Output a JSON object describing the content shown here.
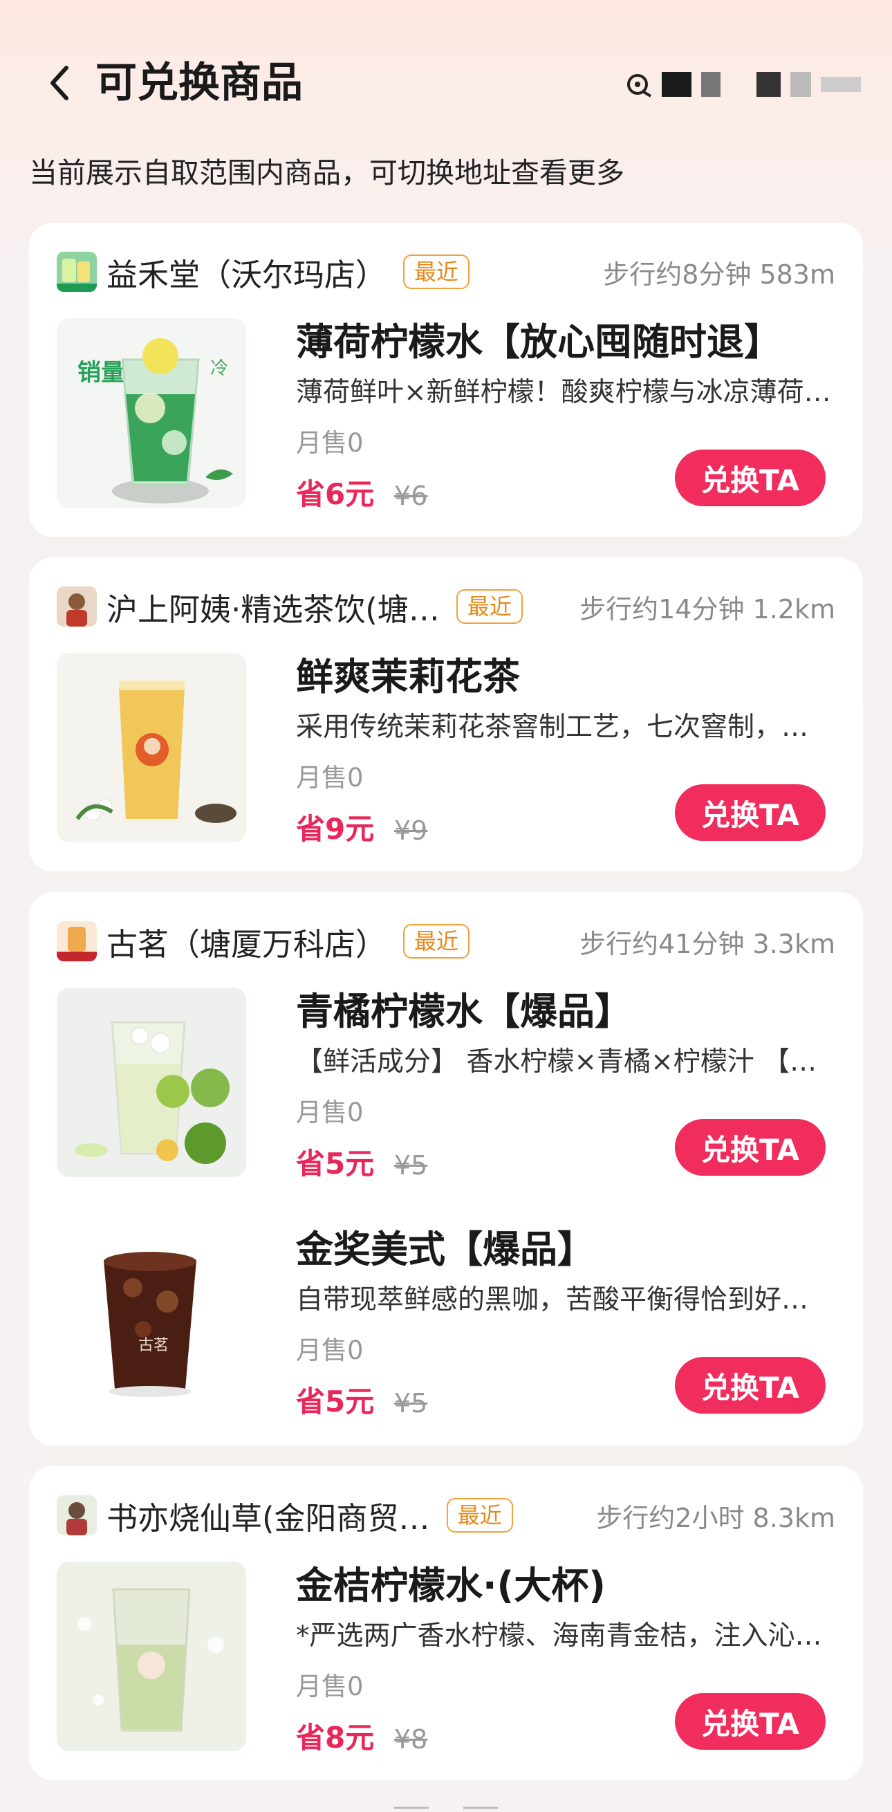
{
  "header": {
    "title": "可兑换商品",
    "subtitle": "当前展示自取范围内商品，可切换地址查看更多"
  },
  "exchange_label": "兑换TA",
  "recent_label": "最近",
  "stores": [
    {
      "name": "益禾堂（沃尔玛店）",
      "distance": "步行约8分钟 583m",
      "products": [
        {
          "name": "薄荷柠檬水【放心囤随时退】",
          "desc": "薄荷鲜叶×新鲜柠檬！酸爽柠檬与冰凉薄荷…",
          "sales": "月售0",
          "save": "省6元",
          "price": "¥6",
          "img_text": "销量过亿",
          "img_tag": "冷"
        }
      ]
    },
    {
      "name": "沪上阿姨·精选茶饮(塘…",
      "distance": "步行约14分钟 1.2km",
      "products": [
        {
          "name": "鲜爽茉莉花茶",
          "desc": "采用传统茉莉花茶窨制工艺，七次窨制，…",
          "sales": "月售0",
          "save": "省9元",
          "price": "¥9"
        }
      ]
    },
    {
      "name": "古茗（塘厦万科店）",
      "distance": "步行约41分钟 3.3km",
      "products": [
        {
          "name": "青橘柠檬水【爆品】",
          "desc": "【鲜活成分】 香水柠檬×青橘×柠檬汁 【鲜…",
          "sales": "月售0",
          "save": "省5元",
          "price": "¥5"
        },
        {
          "name": "金奖美式【爆品】",
          "desc": "自带现萃鲜感的黑咖，苦酸平衡得恰到好…",
          "sales": "月售0",
          "save": "省5元",
          "price": "¥5",
          "img_text": "古茗"
        }
      ]
    },
    {
      "name": "书亦烧仙草(金阳商贸…",
      "distance": "步行约2小时 8.3km",
      "products": [
        {
          "name": "金桔柠檬水·(大杯)",
          "desc": "*严选两广香水柠檬、海南青金桔，注入沁…",
          "sales": "月售0",
          "save": "省8元",
          "price": "¥8"
        }
      ]
    }
  ],
  "colors": {
    "accent": "#f02d5d",
    "save_text": "#e8285a",
    "badge": "#e48a1c"
  }
}
